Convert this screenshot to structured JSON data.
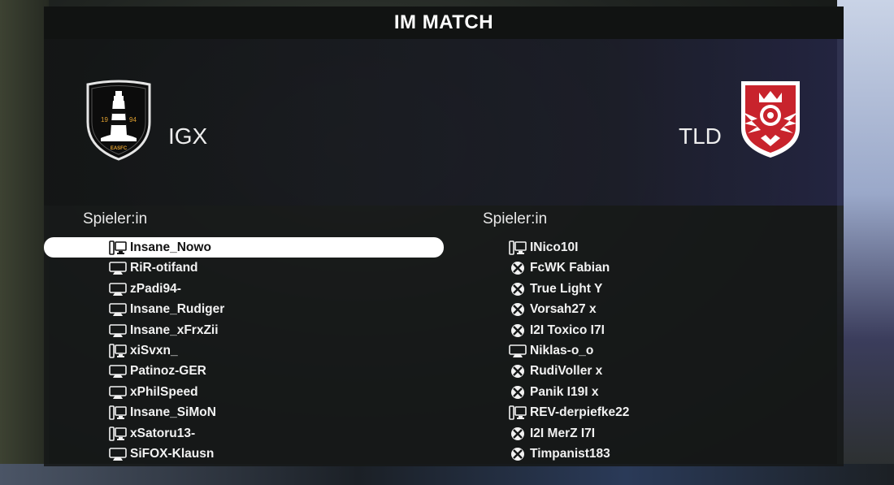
{
  "title": "IM MATCH",
  "home": {
    "name": "IGX",
    "crest_text": [
      "19",
      "94",
      "EASFC"
    ],
    "header": "Spieler:in",
    "players": [
      {
        "name": "Insane_Nowo",
        "platform": "pc-icon",
        "selected": true
      },
      {
        "name": "RiR-otifand",
        "platform": "console-icon"
      },
      {
        "name": "zPadi94-",
        "platform": "console-icon"
      },
      {
        "name": "Insane_Rudiger",
        "platform": "console-icon"
      },
      {
        "name": "Insane_xFrxZii",
        "platform": "console-icon"
      },
      {
        "name": "xiSvxn_",
        "platform": "pc-icon"
      },
      {
        "name": "Patinoz-GER",
        "platform": "console-icon"
      },
      {
        "name": "xPhilSpeed",
        "platform": "console-icon"
      },
      {
        "name": "Insane_SiMoN",
        "platform": "pc-icon"
      },
      {
        "name": "xSatoru13-",
        "platform": "pc-icon"
      },
      {
        "name": "SiFOX-Klausn",
        "platform": "console-icon"
      }
    ]
  },
  "away": {
    "name": "TLD",
    "header": "Spieler:in",
    "players": [
      {
        "name": "INico10I",
        "platform": "pc-icon"
      },
      {
        "name": "FcWK Fabian",
        "platform": "xbox-icon"
      },
      {
        "name": "True Light Y",
        "platform": "xbox-icon"
      },
      {
        "name": "Vorsah27 x",
        "platform": "xbox-icon"
      },
      {
        "name": "I2I Toxico I7I",
        "platform": "xbox-icon"
      },
      {
        "name": "Niklas-o_o",
        "platform": "console-icon"
      },
      {
        "name": "RudiVoller x",
        "platform": "xbox-icon"
      },
      {
        "name": "Panik I19I x",
        "platform": "xbox-icon"
      },
      {
        "name": "REV-derpiefke22",
        "platform": "pc-icon"
      },
      {
        "name": "I2I MerZ I7I",
        "platform": "xbox-icon"
      },
      {
        "name": "Timpanist183",
        "platform": "xbox-icon"
      }
    ]
  },
  "colors": {
    "home_crest_gold": "#e0a030",
    "away_crest_red": "#c8232c",
    "selected_row": "#ffffff"
  }
}
